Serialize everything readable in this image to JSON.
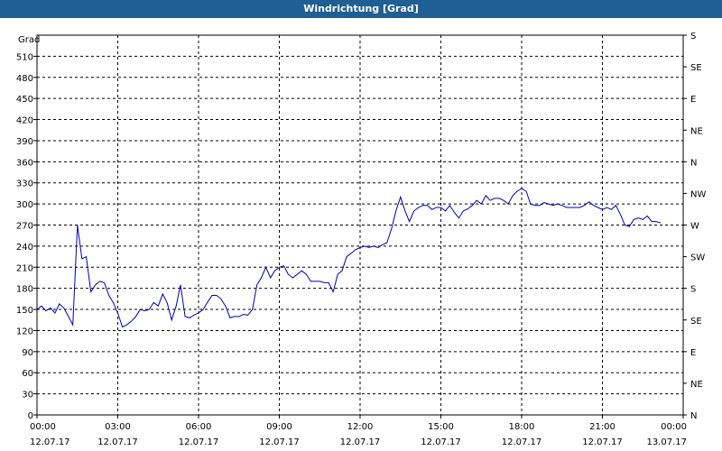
{
  "window": {
    "title": "Windrichtung [Grad]"
  },
  "chart_data": {
    "type": "line",
    "title": "Windrichtung [Grad]",
    "ylabel": "Grad",
    "xlim": [
      "12.07.17 00:00",
      "13.07.17 00:00"
    ],
    "ylim": [
      0,
      540
    ],
    "yticks": [
      0,
      30,
      60,
      90,
      120,
      150,
      180,
      210,
      240,
      270,
      300,
      330,
      360,
      390,
      420,
      450,
      480,
      510
    ],
    "y2ticks": [
      {
        "value": 0,
        "label": "N"
      },
      {
        "value": 45,
        "label": "NE"
      },
      {
        "value": 90,
        "label": "E"
      },
      {
        "value": 135,
        "label": "SE"
      },
      {
        "value": 180,
        "label": "S"
      },
      {
        "value": 225,
        "label": "SW"
      },
      {
        "value": 270,
        "label": "W"
      },
      {
        "value": 315,
        "label": "NW"
      },
      {
        "value": 360,
        "label": "N"
      },
      {
        "value": 405,
        "label": "NE"
      },
      {
        "value": 450,
        "label": "E"
      },
      {
        "value": 495,
        "label": "SE"
      },
      {
        "value": 540,
        "label": "S"
      }
    ],
    "xticks": [
      {
        "time": "00:00",
        "date": "12.07.17"
      },
      {
        "time": "03:00",
        "date": "12.07.17"
      },
      {
        "time": "06:00",
        "date": "12.07.17"
      },
      {
        "time": "09:00",
        "date": "12.07.17"
      },
      {
        "time": "12:00",
        "date": "12.07.17"
      },
      {
        "time": "15:00",
        "date": "12.07.17"
      },
      {
        "time": "18:00",
        "date": "12.07.17"
      },
      {
        "time": "21:00",
        "date": "12.07.17"
      },
      {
        "time": "00:00",
        "date": "13.07.17"
      }
    ],
    "grid": true,
    "line_color": "#0000b4",
    "series": [
      {
        "x_hours": [
          0.0,
          0.17,
          0.33,
          0.5,
          0.67,
          0.83,
          1.0,
          1.17,
          1.33,
          1.5,
          1.67,
          1.83,
          2.0,
          2.17,
          2.33,
          2.5,
          2.67,
          2.83,
          3.0,
          3.17,
          3.33,
          3.5,
          3.67,
          3.83,
          4.0,
          4.17,
          4.33,
          4.5,
          4.67,
          4.83,
          5.0,
          5.17,
          5.33,
          5.5,
          5.67,
          5.83,
          6.0,
          6.17,
          6.33,
          6.5,
          6.67,
          6.83,
          7.0,
          7.17,
          7.33,
          7.5,
          7.67,
          7.83,
          8.0,
          8.17,
          8.33,
          8.5,
          8.67,
          8.83,
          9.0,
          9.17,
          9.33,
          9.5,
          9.67,
          9.83,
          10.0,
          10.17,
          10.33,
          10.5,
          10.67,
          10.83,
          11.0,
          11.17,
          11.33,
          11.5,
          11.67,
          11.83,
          12.0,
          12.17,
          12.33,
          12.5,
          12.67,
          12.83,
          13.0,
          13.17,
          13.33,
          13.5,
          13.67,
          13.83,
          14.0,
          14.17,
          14.33,
          14.5,
          14.67,
          14.83,
          15.0,
          15.17,
          15.33,
          15.5,
          15.67,
          15.83,
          16.0,
          16.17,
          16.33,
          16.5,
          16.67,
          16.83,
          17.0,
          17.17,
          17.33,
          17.5,
          17.67,
          17.83,
          18.0,
          18.17,
          18.33,
          18.5,
          18.67,
          18.83,
          19.0,
          19.17,
          19.33,
          19.5,
          19.67,
          19.83,
          20.0,
          20.17,
          20.33,
          20.5,
          20.67,
          20.83,
          21.0,
          21.17,
          21.33,
          21.5,
          21.67,
          21.83,
          22.0,
          22.17,
          22.33,
          22.5,
          22.67,
          22.83,
          23.0,
          23.17,
          23.33,
          23.5,
          23.67,
          23.83
        ],
        "values": [
          150,
          155,
          148,
          152,
          145,
          158,
          152,
          140,
          128,
          270,
          222,
          225,
          175,
          185,
          190,
          188,
          170,
          160,
          145,
          125,
          128,
          133,
          140,
          150,
          148,
          150,
          160,
          155,
          172,
          160,
          135,
          155,
          185,
          140,
          138,
          142,
          145,
          150,
          160,
          170,
          170,
          165,
          155,
          138,
          140,
          140,
          143,
          142,
          150,
          185,
          195,
          210,
          195,
          205,
          210,
          212,
          200,
          195,
          200,
          205,
          200,
          190,
          190,
          190,
          188,
          188,
          175,
          200,
          205,
          225,
          230,
          235,
          238,
          240,
          238,
          240,
          238,
          242,
          245,
          265,
          290,
          310,
          290,
          275,
          290,
          295,
          298,
          298,
          292,
          295,
          295,
          290,
          298,
          288,
          280,
          290,
          293,
          298,
          305,
          300,
          312,
          305,
          308,
          308,
          305,
          300,
          312,
          318,
          322,
          318,
          300,
          298,
          298,
          302,
          300,
          298,
          300,
          298,
          295,
          295,
          295,
          295,
          298,
          303,
          298,
          295,
          292,
          295,
          292,
          298,
          285,
          270,
          268,
          278,
          280,
          278,
          283,
          275,
          275,
          273
        ]
      }
    ]
  }
}
